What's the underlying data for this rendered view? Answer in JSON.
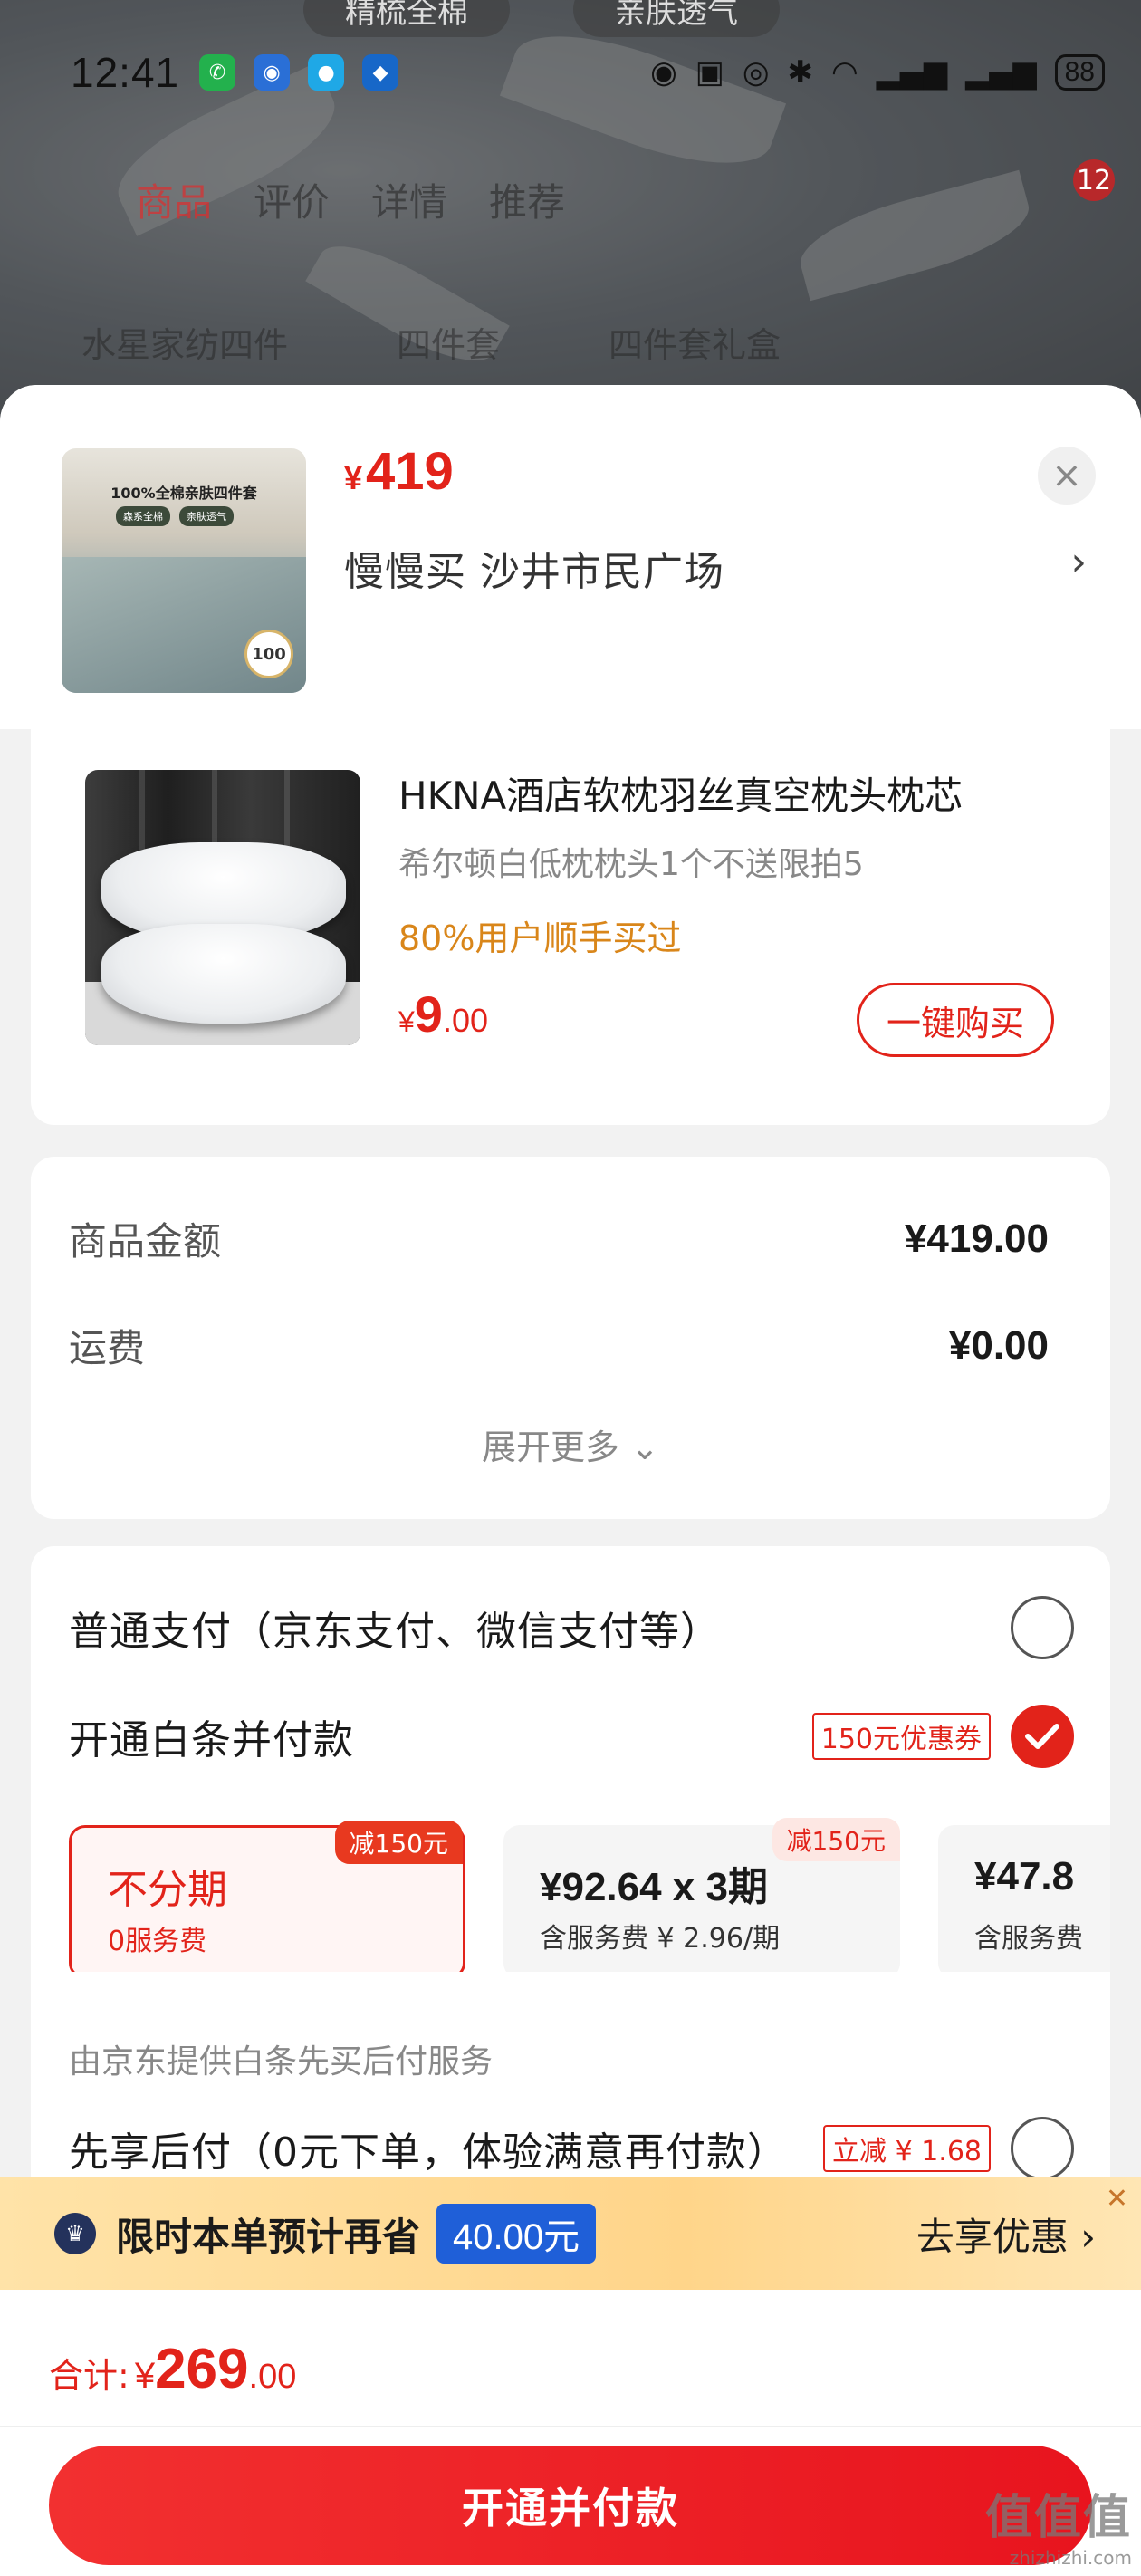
{
  "status_bar": {
    "time": "12:41",
    "battery": "88"
  },
  "background_page": {
    "top_tabs": [
      "精梳全棉",
      "亲肤透气"
    ],
    "nav_tabs": [
      "商品",
      "评价",
      "详情",
      "推荐"
    ],
    "cart_badge": "12",
    "search_hints": [
      "水星家纺四件",
      "四件套",
      "四件套礼盒"
    ]
  },
  "header": {
    "price_symbol": "¥",
    "price": "419",
    "address": "慢慢买  沙井市民广场",
    "thumb_caption": "100%全棉亲肤四件套",
    "thumb_tags": [
      "森系全棉",
      "亲肤透气"
    ],
    "thumb_seal": "100"
  },
  "recommendation": {
    "name": "HKNA酒店软枕羽丝真空枕头枕芯",
    "sub": "希尔顿白低枕枕头1个不送限拍5",
    "hint": "80%用户顺手买过",
    "price_symbol": "¥",
    "price_int": "9",
    "price_dec": ".00",
    "buy_label": "一键购买"
  },
  "amount": {
    "goods_label": "商品金额",
    "goods_value": "¥419.00",
    "shipping_label": "运费",
    "shipping_value": "¥0.00",
    "expand_label": "展开更多"
  },
  "payment": {
    "normal_label": "普通支付（京东支付、微信支付等）",
    "baitiao_label": "开通白条并付款",
    "baitiao_coupon": "150元优惠券",
    "plans": [
      {
        "top": "不分期",
        "bottom": "0服务费",
        "badge": "减150元"
      },
      {
        "top": "¥92.64 x 3期",
        "bottom": "含服务费 ¥ 2.96/期",
        "badge": "减150元"
      },
      {
        "top": "¥47.8",
        "bottom": "含服务费"
      }
    ],
    "provider_note": "由京东提供白条先买后付服务",
    "later_label": "先享后付（0元下单，体验满意再付款）",
    "later_tag": "立减 ¥ 1.68"
  },
  "promo": {
    "text": "限时本单预计再省",
    "save": "40.00元",
    "action": "去享优惠"
  },
  "footer": {
    "total_label": "合计:",
    "total_symbol": "¥",
    "total_int": "269",
    "total_dec": ".00",
    "pay_label": "开通并付款"
  },
  "watermark": {
    "brand": "值值值",
    "url": "zhizhizhi.com"
  },
  "colors": {
    "accent": "#e2231a",
    "promo_bg": "#ffd58a",
    "save_badge": "#1f5fd8"
  }
}
